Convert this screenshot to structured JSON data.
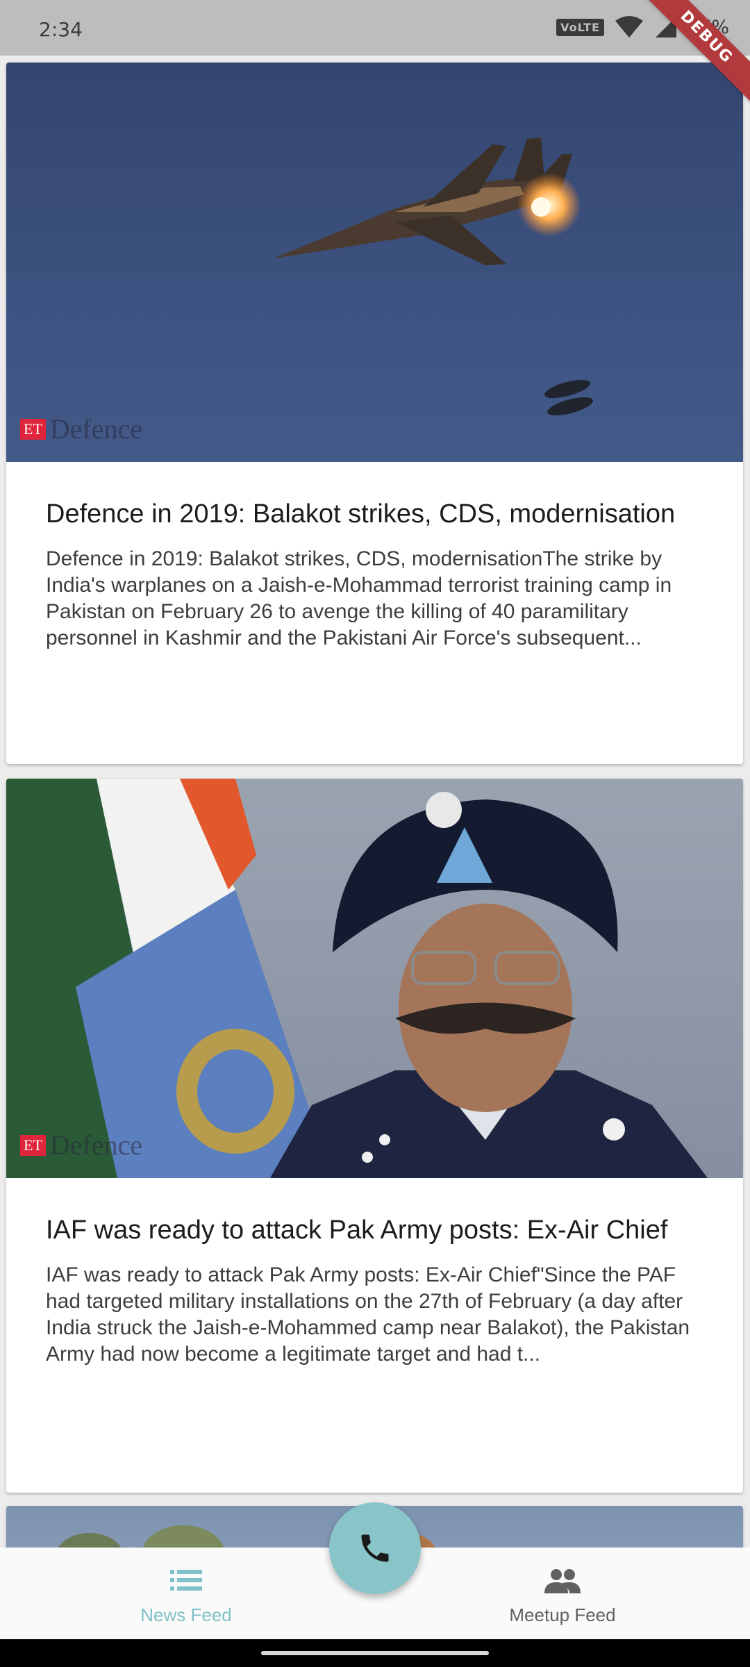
{
  "status_bar": {
    "time": "2:34",
    "network": "VoLTE",
    "battery": "77%"
  },
  "debug_banner": "DEBUG",
  "articles": [
    {
      "image_caption": "Fighter jet firing flares over a blue sky",
      "watermark_box": "ET",
      "watermark_word": "Defence",
      "title": "Defence in 2019: Balakot strikes, CDS, modernisation",
      "description": "Defence in 2019: Balakot strikes, CDS, modernisationThe strike by India's warplanes on a Jaish-e-Mohammad terrorist training camp in Pakistan on February 26 to avenge the killing of 40 paramilitary personnel in Kashmir and the Pakistani Air Force's subsequent..."
    },
    {
      "image_caption": "Former Air Chief in uniform and turban in front of IAF flags",
      "watermark_box": "ET",
      "watermark_word": "Defence",
      "title": "IAF was ready to attack Pak Army posts: Ex-Air Chief",
      "description": "IAF was ready to attack Pak Army posts: Ex-Air Chief\"Since the PAF had targeted military installations on the 27th of February (a day after India struck the Jaish-e-Mohammed camp near Balakot), the Pakistan Army had now become a legitimate target and had t..."
    }
  ],
  "bottom_nav": {
    "news_feed_label": "News Feed",
    "meetup_feed_label": "Meetup Feed"
  },
  "colors": {
    "accent": "#7fc1c8",
    "fab": "#89c4c8",
    "debug": "#b2393c"
  },
  "icons": {
    "fab": "phone-icon",
    "news": "list-icon",
    "meetup": "people-icon"
  }
}
